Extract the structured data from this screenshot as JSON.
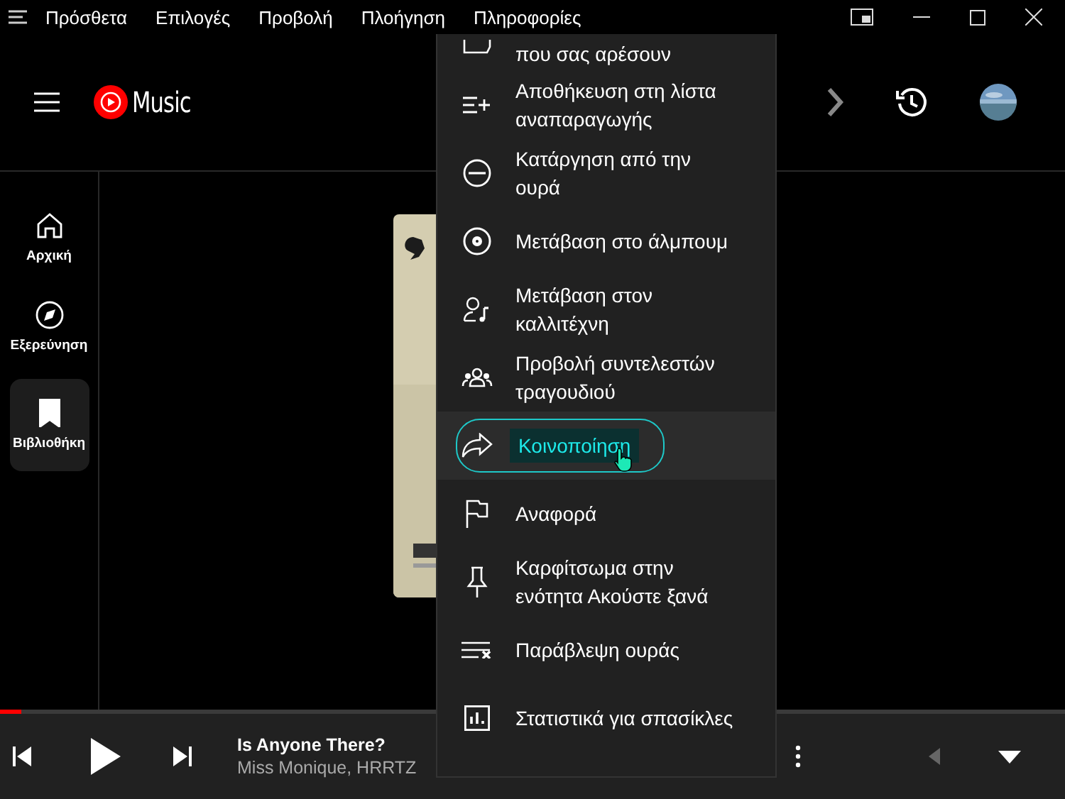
{
  "menu_bar": {
    "items": [
      "Πρόσθετα",
      "Επιλογές",
      "Προβολή",
      "Πλοήγηση",
      "Πληροφορίες"
    ]
  },
  "header": {
    "logo_text": "Music"
  },
  "sidebar": {
    "items": [
      {
        "label": "Αρχική",
        "kind": "home",
        "selected": false
      },
      {
        "label": "Εξερεύνηση",
        "kind": "explore",
        "selected": false
      },
      {
        "label": "Βιβλιοθήκη",
        "kind": "library",
        "selected": true
      }
    ]
  },
  "context_menu": {
    "items": [
      {
        "label": "που σας αρέσουν",
        "kind": "liked",
        "selected": false
      },
      {
        "label": "Αποθήκευση στη λίστα αναπαραγωγής",
        "kind": "playlist-add",
        "selected": false
      },
      {
        "label": "Κατάργηση από την ουρά",
        "kind": "remove",
        "selected": false
      },
      {
        "label": "Μετάβαση στο άλμπουμ",
        "kind": "album",
        "selected": false
      },
      {
        "label": "Μετάβαση στον καλλιτέχνη",
        "kind": "artist",
        "selected": false
      },
      {
        "label": "Προβολή συντελεστών τραγουδιού",
        "kind": "credits",
        "selected": false
      },
      {
        "label": "Κοινοποίηση",
        "kind": "share",
        "selected": true
      },
      {
        "label": "Αναφορά",
        "kind": "flag",
        "selected": false
      },
      {
        "label": "Καρφίτσωμα στην ενότητα Ακούστε ξανά",
        "kind": "pin",
        "selected": false
      },
      {
        "label": "Παράβλεψη ουράς",
        "kind": "dismiss-queue",
        "selected": false
      },
      {
        "label": "Στατιστικά για σπασίκλες",
        "kind": "stats",
        "selected": false
      }
    ]
  },
  "player": {
    "progress": {
      "level": 0.02
    },
    "title": "Is Anyone There?",
    "artist": "Miss Monique, HRRTZ"
  }
}
